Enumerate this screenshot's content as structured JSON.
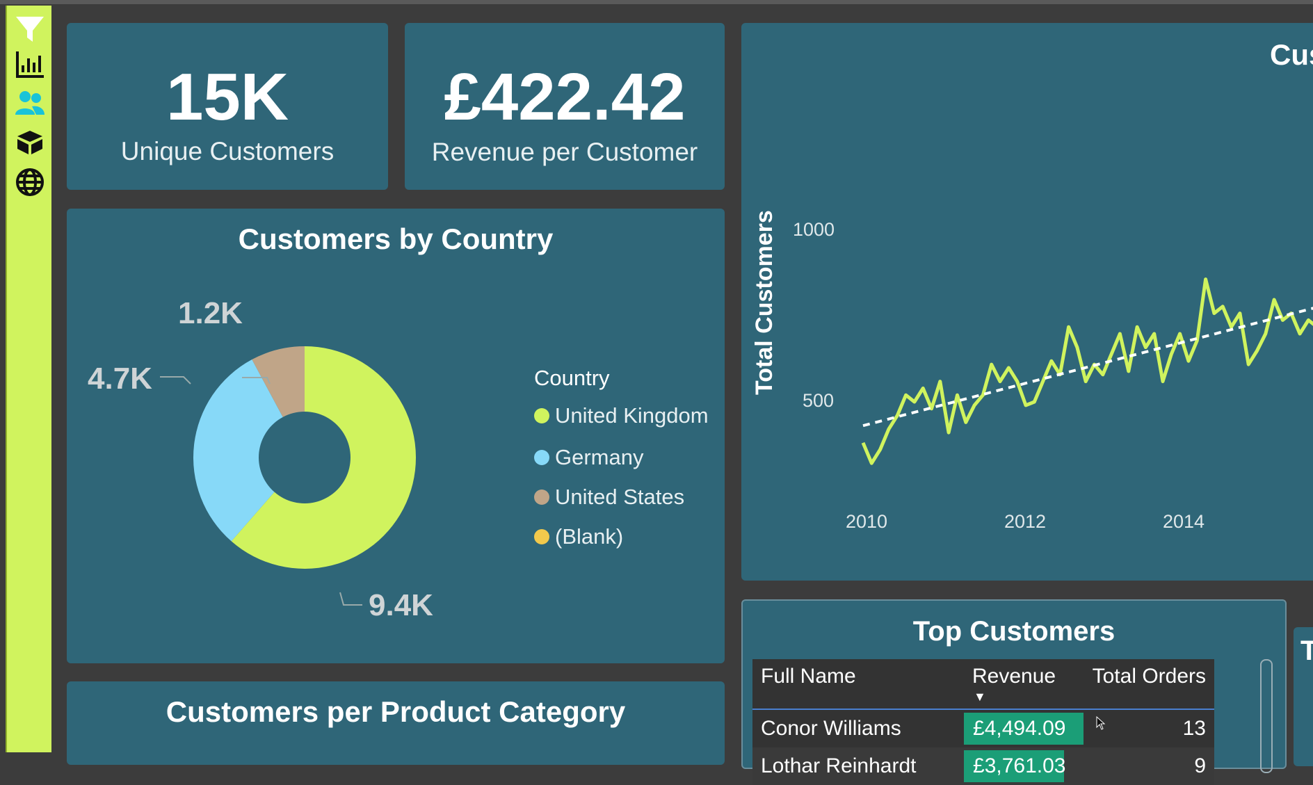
{
  "kpis": {
    "unique_customers": {
      "value": "15K",
      "label": "Unique Customers"
    },
    "revenue_per_customer": {
      "value": "£422.42",
      "label": "Revenue per Customer"
    }
  },
  "nav_icons": [
    "filter-icon",
    "bar-chart-icon",
    "users-icon",
    "box-icon",
    "globe-icon"
  ],
  "donut": {
    "title": "Customers by Country",
    "legend_title": "Country",
    "legend": [
      {
        "label": "United Kingdom",
        "color": "#d0f35e"
      },
      {
        "label": "Germany",
        "color": "#87d9f8"
      },
      {
        "label": "United States",
        "color": "#c0a588"
      },
      {
        "label": "(Blank)",
        "color": "#f2c94c"
      }
    ],
    "labels": {
      "uk": "9.4K",
      "germany": "4.7K",
      "us": "1.2K"
    }
  },
  "line": {
    "title_partial": "Cus",
    "ylabel": "Total Customers",
    "yticks": [
      "1000",
      "500"
    ],
    "xticks": [
      "2010",
      "2012",
      "2014"
    ]
  },
  "bottom_left": {
    "title": "Customers per Product Category"
  },
  "table": {
    "title": "Top Customers",
    "columns": [
      "Full Name",
      "Revenue",
      "Total Orders"
    ],
    "rows": [
      {
        "name": "Conor Williams",
        "revenue": "£4,494.09",
        "orders": "13"
      },
      {
        "name": "Lothar Reinhardt",
        "revenue": "£3,761.03",
        "orders": "9"
      }
    ]
  },
  "right_partial_title": "T",
  "chart_data": [
    {
      "type": "pie",
      "title": "Customers by Country",
      "categories": [
        "United Kingdom",
        "Germany",
        "United States",
        "(Blank)"
      ],
      "values": [
        9400,
        4700,
        1200,
        0
      ]
    },
    {
      "type": "line",
      "ylabel": "Total Customers",
      "ylim": [
        300,
        1100
      ],
      "xticks": [
        "2010",
        "2012",
        "2014"
      ],
      "series": [
        {
          "x": [
            2010.0,
            2010.1,
            2010.2,
            2010.3,
            2010.4,
            2010.5,
            2010.6,
            2010.7,
            2010.8,
            2010.9,
            2011.0,
            2011.1,
            2011.2,
            2011.3,
            2011.4,
            2011.5,
            2011.6,
            2011.7,
            2011.8,
            2011.9,
            2012.0,
            2012.1,
            2012.2,
            2012.3,
            2012.4,
            2012.5,
            2012.6,
            2012.7,
            2012.8,
            2012.9,
            2013.0,
            2013.1,
            2013.2,
            2013.3,
            2013.4,
            2013.5,
            2013.6,
            2013.7,
            2013.8,
            2013.9,
            2014.0,
            2014.1,
            2014.2,
            2014.3,
            2014.4,
            2014.5,
            2014.6,
            2014.7,
            2014.8,
            2014.9,
            2015.0,
            2015.1,
            2015.2,
            2015.3,
            2015.4
          ],
          "y": [
            380,
            320,
            360,
            420,
            460,
            520,
            500,
            540,
            480,
            560,
            410,
            520,
            440,
            490,
            520,
            610,
            560,
            600,
            560,
            490,
            500,
            560,
            620,
            580,
            720,
            660,
            560,
            610,
            580,
            640,
            700,
            590,
            720,
            660,
            700,
            560,
            640,
            700,
            620,
            680,
            860,
            760,
            780,
            720,
            760,
            610,
            650,
            700,
            800,
            740,
            760,
            700,
            740,
            720,
            760
          ]
        }
      ]
    }
  ]
}
